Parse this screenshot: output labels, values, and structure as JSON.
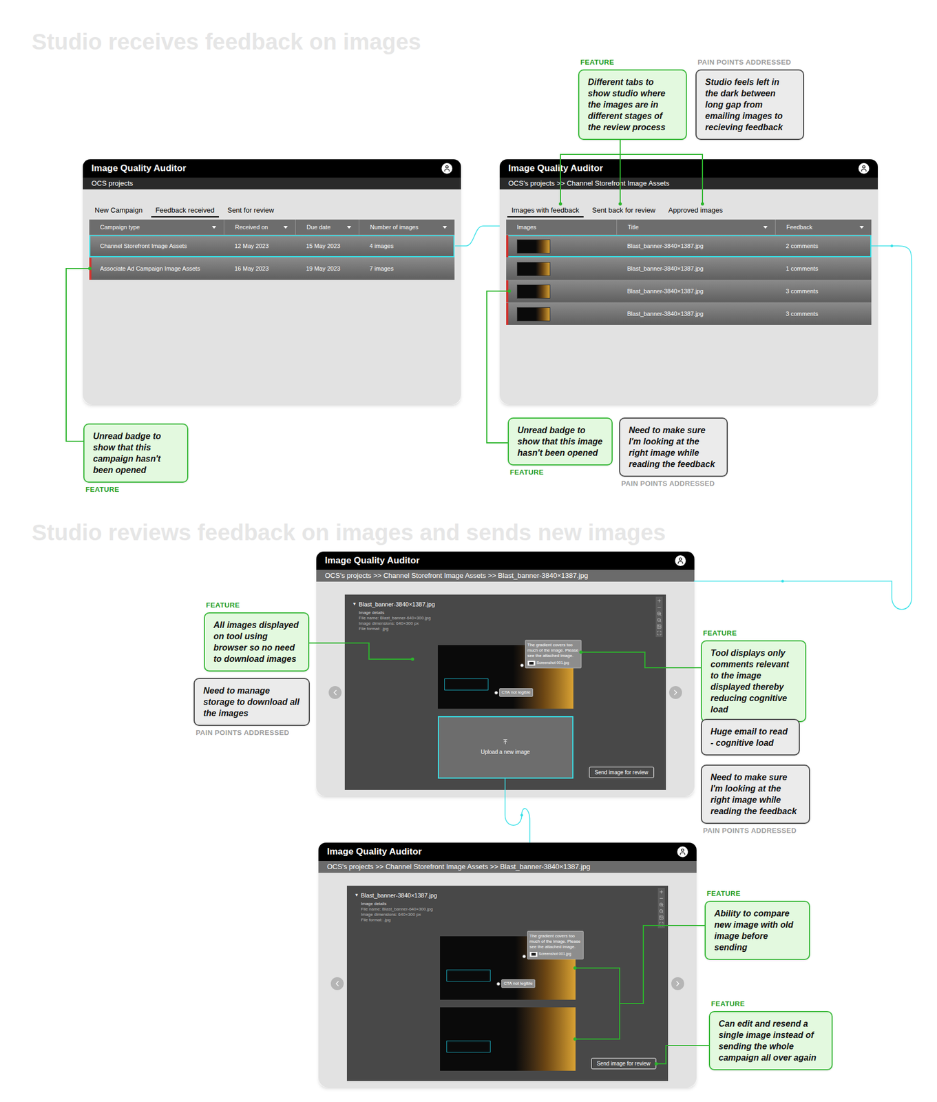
{
  "headings": [
    "Studio receives feedback on images",
    "Studio reviews feedback on images and sends new images"
  ],
  "screens": [
    {
      "kind": "campaigns",
      "title": "Image Quality Auditor",
      "breadcrumb": "OCS projects",
      "tabs": [
        {
          "label": "New Campaign",
          "selected": false
        },
        {
          "label": "Feedback received",
          "selected": true
        },
        {
          "label": "Sent for review",
          "selected": false
        }
      ],
      "columns": [
        {
          "label": "Campaign type",
          "sortable": true
        },
        {
          "label": "Received on",
          "sortable": true
        },
        {
          "label": "Due date",
          "sortable": true
        },
        {
          "label": "Number of images",
          "sortable": true
        }
      ],
      "rows": [
        {
          "cells": [
            "Channel Storefront Image Assets",
            "12 May 2023",
            "15 May 2023",
            "4 images"
          ],
          "unread": false,
          "highlighted": true
        },
        {
          "cells": [
            "Associate Ad Campaign Image Assets",
            "16 May 2023",
            "19 May 2023",
            "7 images"
          ],
          "unread": true,
          "highlighted": false
        }
      ]
    },
    {
      "kind": "images",
      "title": "Image Quality Auditor",
      "breadcrumb": "OCS's projects >> Channel Storefront Image Assets",
      "tabs": [
        {
          "label": "Images with feedback",
          "selected": true
        },
        {
          "label": "Sent back for review",
          "selected": false
        },
        {
          "label": "Approved images",
          "selected": false
        }
      ],
      "columns": [
        {
          "label": "Images",
          "sortable": false
        },
        {
          "label": "Title",
          "sortable": true
        },
        {
          "label": "Feedback",
          "sortable": true
        }
      ],
      "rows": [
        {
          "title": "Blast_banner-3840×1387.jpg",
          "feedback": "2 comments",
          "unread": true,
          "highlighted": true
        },
        {
          "title": "Blast_banner-3840×1387.jpg",
          "feedback": "1 comments",
          "unread": false,
          "highlighted": false
        },
        {
          "title": "Blast_banner-3840×1387.jpg",
          "feedback": "3 comments",
          "unread": true,
          "highlighted": false
        },
        {
          "title": "Blast_banner-3840×1387.jpg",
          "feedback": "3 comments",
          "unread": true,
          "highlighted": false
        }
      ]
    },
    {
      "kind": "viewer",
      "title": "Image Quality Auditor",
      "breadcrumb": "OCS's projects >> Channel Storefront Image Assets >> Blast_banner-3840×1387.jpg",
      "file": {
        "toggle": "▼",
        "name": "Blast_banner-3840×1387.jpg",
        "details": [
          "Image details",
          "File name: Blast_banner-640×300.jpg",
          "Image dimensions: 640×300 px",
          "File format: .jpg"
        ]
      },
      "images": [
        {
          "comments": [
            {
              "text": "The gradient covers too much of the image. Please see the attached image.",
              "attachment": "Screenshot 001.jpg"
            },
            {
              "text": "CTA not legible"
            }
          ]
        }
      ],
      "upload": {
        "label": "Upload a new image"
      },
      "button": "Send image for review"
    },
    {
      "kind": "viewer",
      "title": "Image Quality Auditor",
      "breadcrumb": "OCS's projects >> Channel Storefront Image Assets >> Blast_banner-3840×1387.jpg",
      "file": {
        "toggle": "▼",
        "name": "Blast_banner-3840×1387.jpg",
        "details": [
          "Image details",
          "File name: Blast_banner-640×300.jpg",
          "Image dimensions: 640×300 px",
          "File format: .jpg"
        ]
      },
      "images": [
        {
          "comments": [
            {
              "text": "The gradient covers too much of the image. Please see the attached image.",
              "attachment": "Screenshot 001.jpg"
            },
            {
              "text": "CTA not legible"
            }
          ]
        },
        {
          "comments": []
        }
      ],
      "button": "Send image for review"
    }
  ],
  "annotations": [
    {
      "kind": "feature",
      "tag": "FEATURE",
      "text": "Different tabs to show studio where the images are in different stages of the review process"
    },
    {
      "kind": "pain",
      "tag": "PAIN POINTS ADDRESSED",
      "text": "Studio feels left in the dark between long gap from emailing images to recieving feedback"
    },
    {
      "kind": "feature",
      "tag": "FEATURE",
      "text": "Unread badge to show that this campaign hasn't been opened"
    },
    {
      "kind": "feature",
      "tag": "FEATURE",
      "text": "Unread badge to show that this image hasn't been opened"
    },
    {
      "kind": "pain",
      "tag": "PAIN POINTS ADDRESSED",
      "text": "Need to make sure I'm looking at the right image while reading the feedback"
    },
    {
      "kind": "feature",
      "tag": "FEATURE",
      "text": "All images displayed on tool using browser so no need to download images"
    },
    {
      "kind": "pain",
      "tag": "PAIN POINTS ADDRESSED",
      "text": "Need to manage storage to download all the images"
    },
    {
      "kind": "feature",
      "tag": "FEATURE",
      "text": "Tool displays only comments relevant to the image displayed thereby reducing cognitive load"
    },
    {
      "kind": "pain",
      "text": "Huge email to read - cognitive load"
    },
    {
      "kind": "pain",
      "tag": "PAIN POINTS ADDRESSED",
      "text": "Need to make sure I'm looking at the right image while reading the feedback"
    },
    {
      "kind": "feature",
      "tag": "FEATURE",
      "text": "Ability to compare new image with old image before sending"
    },
    {
      "kind": "feature",
      "tag": "FEATURE",
      "text": "Can edit and resend a single image instead of sending the whole campaign all over again"
    }
  ]
}
